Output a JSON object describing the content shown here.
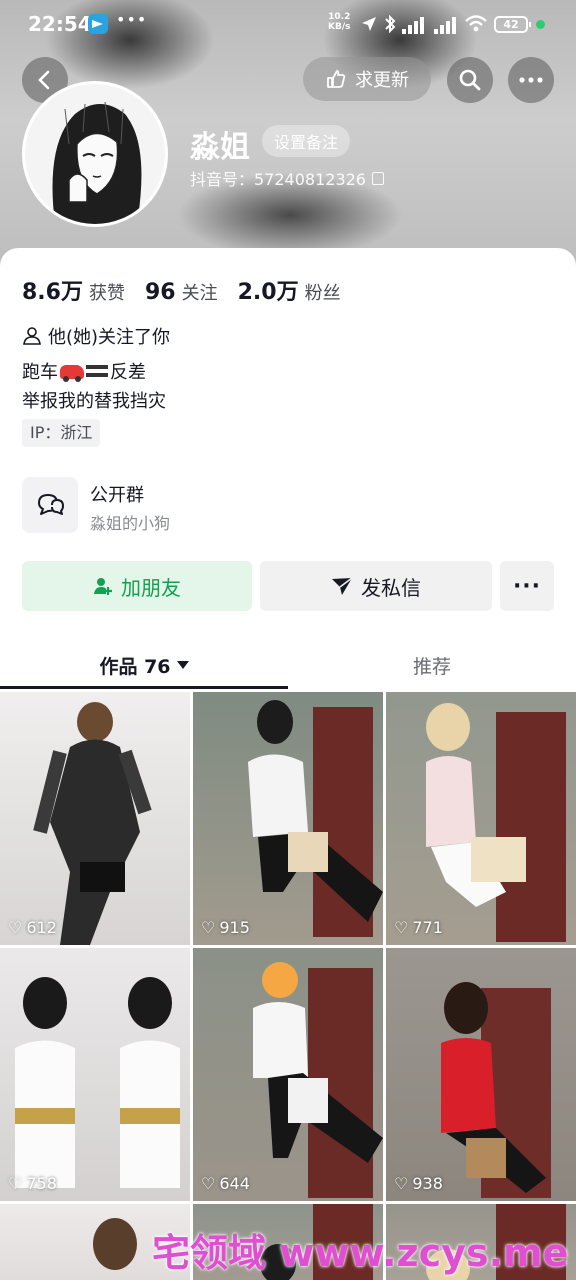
{
  "status_bar": {
    "time": "22:54",
    "net_speed_value": "10.2",
    "net_speed_unit": "KB/s",
    "battery": "42"
  },
  "header": {
    "update_request_label": "求更新",
    "nickname": "淼姐",
    "remark_label": "设置备注",
    "douyin_id": "抖音号：57240812326"
  },
  "stats": [
    {
      "value": "8.6万",
      "label": "获赞"
    },
    {
      "value": "96",
      "label": "关注"
    },
    {
      "value": "2.0万",
      "label": "粉丝"
    }
  ],
  "profile": {
    "follow_note": "他(她)关注了你",
    "bio_line1_a": "跑车",
    "bio_line1_b": "反差",
    "bio_line2": "举报我的替我挡灾",
    "ip": "IP：浙江"
  },
  "group": {
    "title": "公开群",
    "subtitle": "淼姐的小狗"
  },
  "actions": {
    "add_friend": "加朋友",
    "message": "发私信",
    "more": "···"
  },
  "tabs": {
    "works": "作品 76",
    "recommend": "推荐"
  },
  "videos": [
    {
      "likes": "612"
    },
    {
      "likes": "915"
    },
    {
      "likes": "771"
    },
    {
      "likes": "758"
    },
    {
      "likes": "644"
    },
    {
      "likes": "938"
    }
  ],
  "watermark": "宅领域 www.zcys.me",
  "colors": {
    "accent_green": "#13a050",
    "watermark_pink": "#e04fd2"
  }
}
